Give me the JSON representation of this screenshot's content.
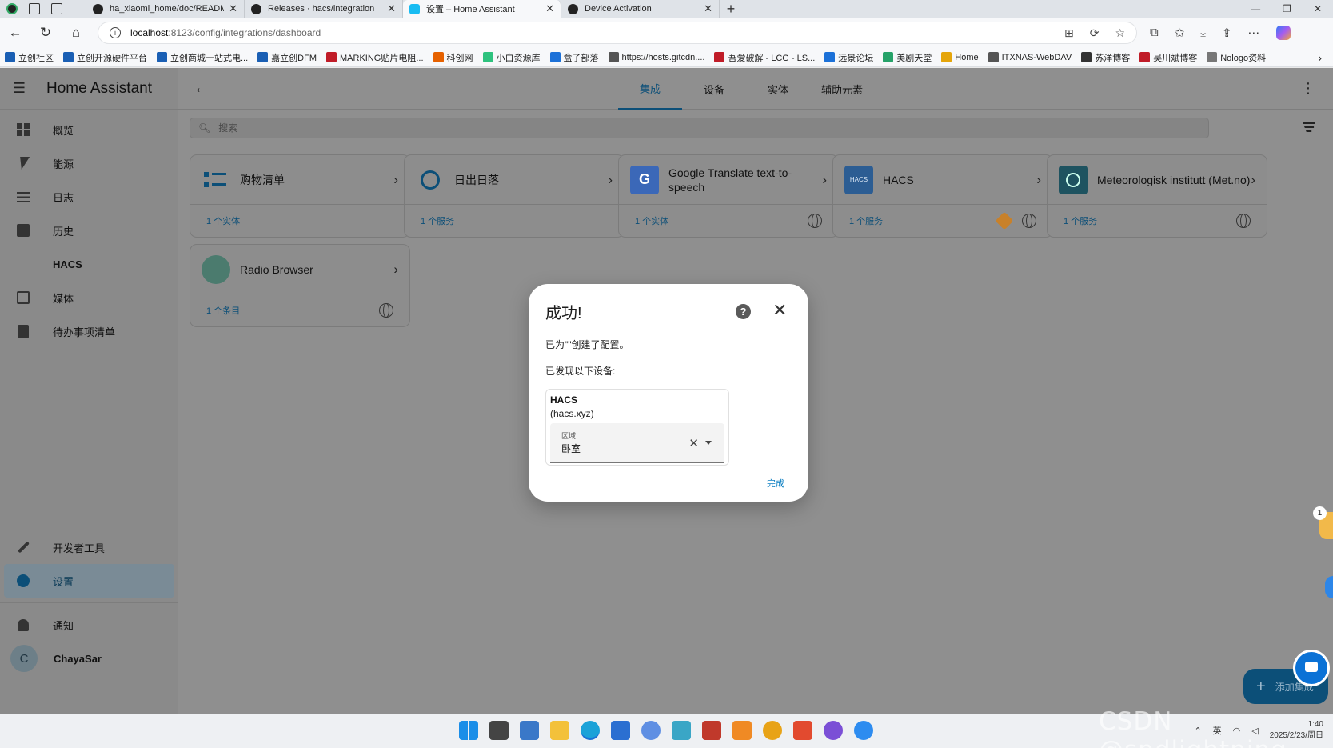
{
  "browser": {
    "tabs": [
      {
        "title": "ha_xiaomi_home/doc/README_zh",
        "active": false,
        "icon": "github-icon"
      },
      {
        "title": "Releases · hacs/integration",
        "active": false,
        "icon": "github-icon"
      },
      {
        "title": "设置 – Home Assistant",
        "active": true,
        "icon": "home-assistant-icon"
      },
      {
        "title": "Device Activation",
        "active": false,
        "icon": "github-icon"
      }
    ],
    "address": {
      "host": "localhost",
      "path": ":8123/config/integrations/dashboard"
    },
    "bookmarks": [
      {
        "label": "立创社区",
        "color": "#1a5fb4"
      },
      {
        "label": "立创开源硬件平台",
        "color": "#1a5fb4"
      },
      {
        "label": "立创商城一站式电...",
        "color": "#1a5fb4"
      },
      {
        "label": "嘉立创DFM",
        "color": "#1a5fb4"
      },
      {
        "label": "MARKING贴片电阻...",
        "color": "#c01c28"
      },
      {
        "label": "科创网",
        "color": "#e66100"
      },
      {
        "label": "小白资源库",
        "color": "#2ec27e"
      },
      {
        "label": "盒子部落",
        "color": "#1c71d8"
      },
      {
        "label": "https://hosts.gitcdn....",
        "color": "#555555"
      },
      {
        "label": "吾爱破解 - LCG - LS...",
        "color": "#c01c28"
      },
      {
        "label": "远景论坛",
        "color": "#1c71d8"
      },
      {
        "label": "美剧天堂",
        "color": "#26a269"
      },
      {
        "label": "Home",
        "color": "#e5a50a"
      },
      {
        "label": "ITXNAS-WebDAV",
        "color": "#555555"
      },
      {
        "label": "苏洋博客",
        "color": "#333333"
      },
      {
        "label": "吴川斌博客",
        "color": "#c01c28"
      },
      {
        "label": "Nologo资料",
        "color": "#777777"
      }
    ]
  },
  "sidebar": {
    "title": "Home Assistant",
    "items": [
      {
        "label": "概览",
        "icon": "dashboard-icon"
      },
      {
        "label": "能源",
        "icon": "lightning-icon"
      },
      {
        "label": "日志",
        "icon": "list-icon"
      },
      {
        "label": "历史",
        "icon": "chart-icon"
      },
      {
        "label": "HACS",
        "icon": "hacs-icon"
      },
      {
        "label": "媒体",
        "icon": "media-icon"
      },
      {
        "label": "待办事项清单",
        "icon": "clipboard-icon"
      }
    ],
    "dev_tools": "开发者工具",
    "settings": "设置",
    "notifications": "通知",
    "user": {
      "initial": "C",
      "name": "ChayaSar"
    }
  },
  "topbar": {
    "tabs": [
      {
        "label": "集成",
        "active": true
      },
      {
        "label": "设备",
        "active": false
      },
      {
        "label": "实体",
        "active": false
      },
      {
        "label": "辅助元素",
        "active": false
      }
    ]
  },
  "search": {
    "placeholder": "搜索"
  },
  "cards": [
    {
      "name": "购物清单",
      "meta": "1 个实体",
      "logo": "shopping-list-icon",
      "globe": false,
      "cube": false
    },
    {
      "name": "日出日落",
      "meta": "1 个服务",
      "logo": "sun-icon",
      "globe": false,
      "cube": false
    },
    {
      "name": "Google Translate text-to-speech",
      "meta": "1 个实体",
      "logo": "google-translate-icon",
      "globe": true,
      "cube": false
    },
    {
      "name": "HACS",
      "meta": "1 个服务",
      "logo": "hacs-logo-icon",
      "globe": true,
      "cube": true
    },
    {
      "name": "Meteorologisk institutt (Met.no)",
      "meta": "1 个服务",
      "logo": "met-no-icon",
      "globe": true,
      "cube": false
    },
    {
      "name": "Radio Browser",
      "meta": "1 个条目",
      "logo": "radio-browser-icon",
      "globe": true,
      "cube": false
    }
  ],
  "dialog": {
    "title": "成功!",
    "message": "已为\"\"创建了配置。",
    "found": "已发现以下设备:",
    "device": {
      "name": "HACS",
      "model": "(hacs.xyz)"
    },
    "area": {
      "label": "区域",
      "value": "卧室"
    },
    "done": "完成"
  },
  "fab": {
    "label": "添加集成"
  },
  "edge_badge": "1",
  "taskbar": {
    "time": "1:40",
    "date": "2025/2/23/周日",
    "ime": "英"
  },
  "watermark": "CSDN @spdlightning"
}
